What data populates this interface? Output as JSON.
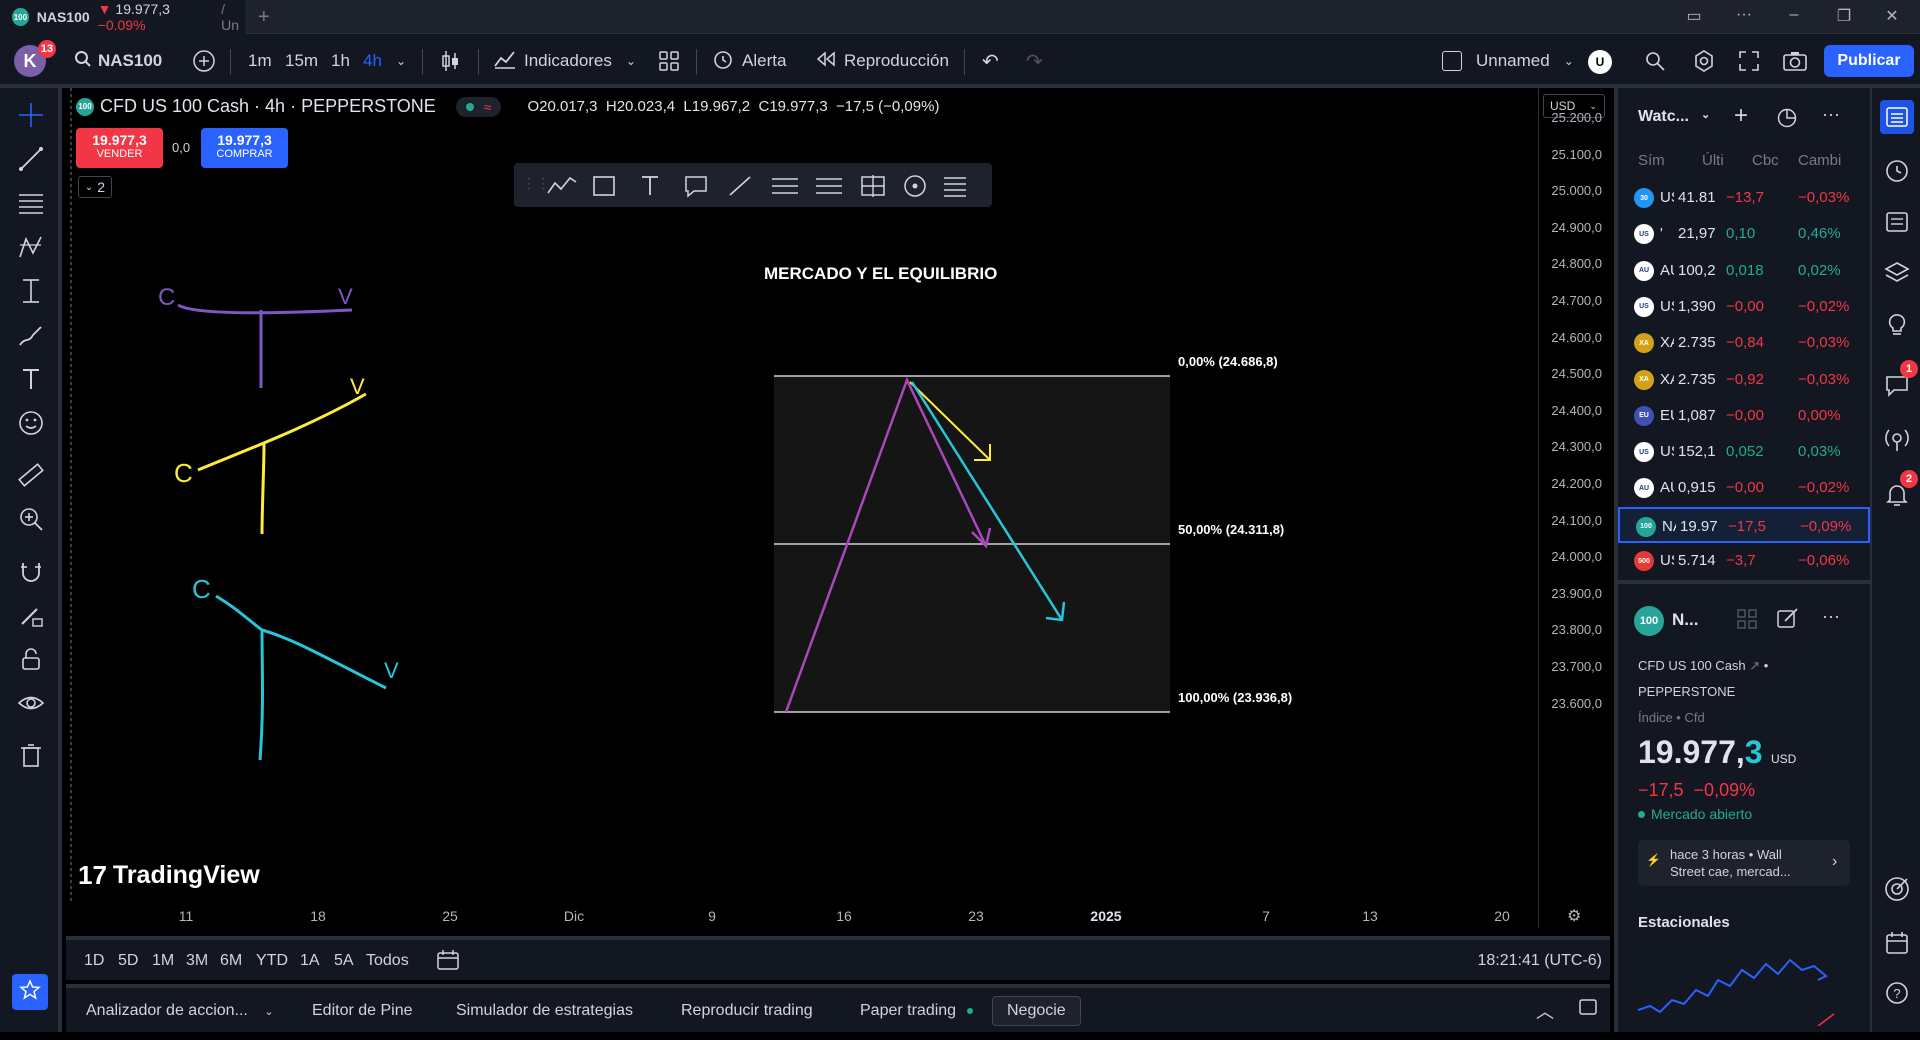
{
  "window": {
    "tab_title": "NAS100",
    "tab_price": "19.977,3",
    "tab_change": "−0.09%",
    "tab_rest": "/ Un"
  },
  "toolbar": {
    "avatar_letter": "K",
    "avatar_badge": "13",
    "symbol": "NAS100",
    "intervals": [
      "1m",
      "15m",
      "1h",
      "4h"
    ],
    "active_interval": "4h",
    "indicators": "Indicadores",
    "alert": "Alerta",
    "replay": "Reproducción",
    "layout_name": "Unnamed",
    "user_letter": "U",
    "publish": "Publicar"
  },
  "legend": {
    "symbol_title": "CFD US 100 Cash · 4h · PEPPERSTONE",
    "ohlc": "O20.017,3  H20.023,4  L19.967,2  C19.977,3  −17,5 (−0,09%)",
    "sell_price": "19.977,3",
    "sell_label": "VENDER",
    "spread": "0,0",
    "buy_price": "19.977,3",
    "buy_label": "COMPRAR",
    "indicators_count": "2",
    "currency": "USD"
  },
  "chart_text": {
    "title": "MERCADO Y EL EQUILIBRIO",
    "fib_0": "0,00% (24.686,8)",
    "fib_50": "50,00% (24.311,8)",
    "fib_100": "100,00% (23.936,8)",
    "watermark": "TradingView",
    "hand_c1": "C",
    "hand_v1": "V",
    "hand_c2": "C",
    "hand_v2": "V",
    "hand_c3": "C",
    "hand_v3": "V"
  },
  "price_axis": [
    "25.200,0",
    "25.100,0",
    "25.000,0",
    "24.900,0",
    "24.800,0",
    "24.700,0",
    "24.600,0",
    "24.500,0",
    "24.400,0",
    "24.300,0",
    "24.200,0",
    "24.100,0",
    "24.000,0",
    "23.900,0",
    "23.800,0",
    "23.700,0",
    "23.600,0"
  ],
  "time_axis": [
    "11",
    "18",
    "25",
    "Dic",
    "9",
    "16",
    "23",
    "2025",
    "7",
    "13",
    "20"
  ],
  "ranges": [
    "1D",
    "5D",
    "1M",
    "3M",
    "6M",
    "YTD",
    "1A",
    "5A",
    "Todos"
  ],
  "clock": "18:21:41 (UTC-6)",
  "bottom_tabs": [
    "Analizador de accion...",
    "Editor de Pine",
    "Simulador de estrategias",
    "Reproducir trading",
    "Paper trading",
    "Negocie"
  ],
  "watchlist": {
    "title": "Watc...",
    "headers": [
      "Sím",
      "Últi",
      "Cbc",
      "Cambi"
    ],
    "rows": [
      {
        "icon": "30",
        "icon_color": "#2196f3",
        "sym": "US",
        "last": "41.81",
        "chg": "−13,7",
        "pct": "−0,03%",
        "dir": "neg"
      },
      {
        "icon": "US",
        "icon_color": "#ffffff",
        "sym": "'",
        "last": "21,97",
        "chg": "0,10",
        "pct": "0,46%",
        "dir": "pos"
      },
      {
        "icon": "AU",
        "icon_color": "#ffffff",
        "sym": "AU",
        "last": "100,2",
        "chg": "0,018",
        "pct": "0,02%",
        "dir": "pos"
      },
      {
        "icon": "US",
        "icon_color": "#ffffff",
        "sym": "US",
        "last": "1,390",
        "chg": "−0,00",
        "pct": "−0,02%",
        "dir": "neg"
      },
      {
        "icon": "XA",
        "icon_color": "#d4a017",
        "sym": "XA",
        "last": "2.735",
        "chg": "−0,84",
        "pct": "−0,03%",
        "dir": "neg"
      },
      {
        "icon": "XA",
        "icon_color": "#d4a017",
        "sym": "XA",
        "last": "2.735",
        "chg": "−0,92",
        "pct": "−0,03%",
        "dir": "neg"
      },
      {
        "icon": "EU",
        "icon_color": "#3f51b5",
        "sym": "EU",
        "last": "1,087",
        "chg": "−0,00",
        "pct": "0,00%",
        "dir": "neg"
      },
      {
        "icon": "US",
        "icon_color": "#ffffff",
        "sym": "US",
        "last": "152,1",
        "chg": "0,052",
        "pct": "0,03%",
        "dir": "pos"
      },
      {
        "icon": "AU",
        "icon_color": "#ffffff",
        "sym": "AU",
        "last": "0,915",
        "chg": "−0,00",
        "pct": "−0,02%",
        "dir": "neg"
      },
      {
        "icon": "100",
        "icon_color": "#26a69a",
        "sym": "NA",
        "last": "19.97",
        "chg": "−17,5",
        "pct": "−0,09%",
        "dir": "neg"
      },
      {
        "icon": "500",
        "icon_color": "#e53935",
        "sym": "US",
        "last": "5.714",
        "chg": "−3,7",
        "pct": "−0,06%",
        "dir": "neg"
      }
    ]
  },
  "details": {
    "icon": "100",
    "short": "N...",
    "name": "CFD US 100 Cash",
    "exchange": "PEPPERSTONE",
    "type": "Índice • Cfd",
    "price_main": "19.977,",
    "price_last": "3",
    "currency": "USD",
    "change": "−17,5  −0,09%",
    "market": "Mercado abierto",
    "news": "hace 3 horas • Wall Street cae, mercad...",
    "seasonals": "Estacionales"
  },
  "badges": {
    "chat": "1",
    "alerts": "2"
  },
  "colors": {
    "accent": "#2962ff",
    "negative": "#f23645",
    "positive": "#22ab94",
    "purple": "#7e57c2",
    "yellow": "#ffeb3b",
    "cyan": "#26c6da",
    "magenta": "#ab47bc"
  }
}
